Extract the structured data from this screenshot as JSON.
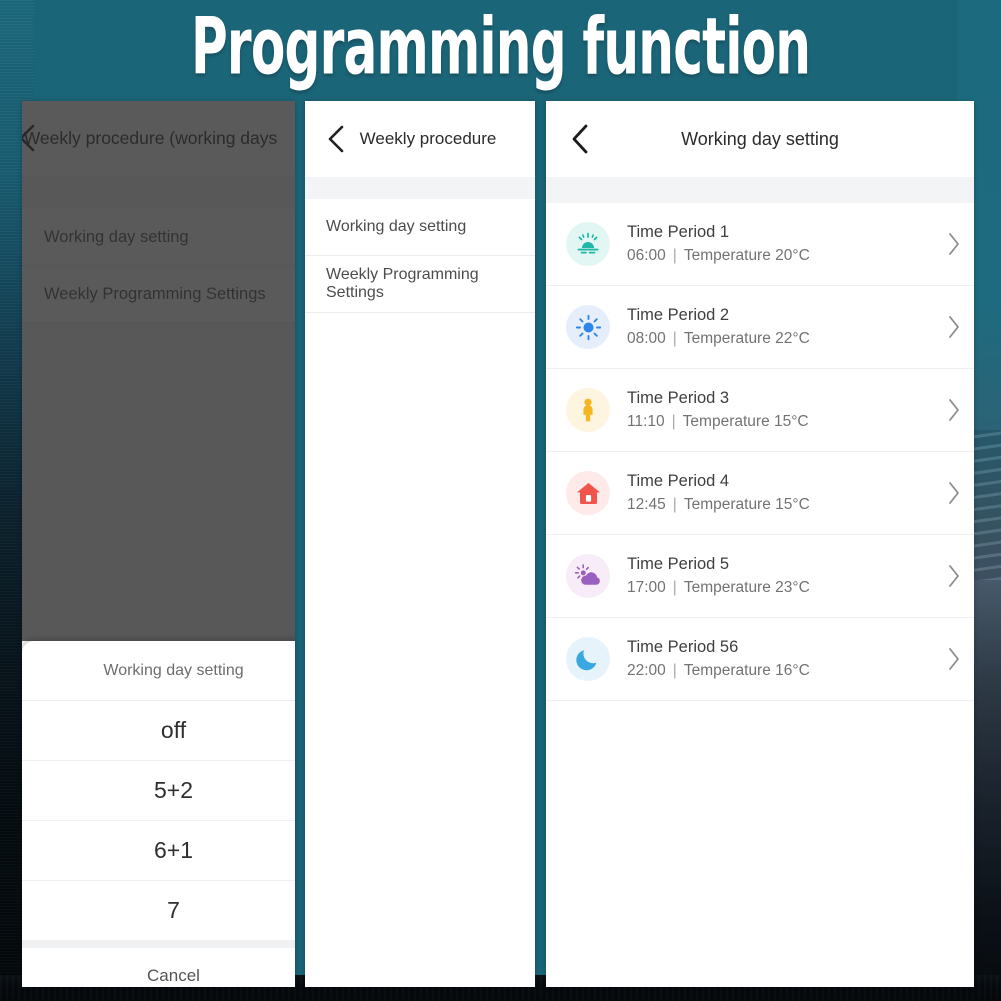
{
  "page": {
    "title": "Programming function",
    "accent_teal": "#1b6578",
    "title_color": "#ffffff"
  },
  "panel1": {
    "header": {
      "back_icon": "chevron-left-icon",
      "title": "Weekly procedure (working days"
    },
    "items": [
      {
        "label": "Working day setting"
      },
      {
        "label": "Weekly Programming Settings"
      }
    ],
    "action_sheet": {
      "title": "Working day setting",
      "options": [
        {
          "label": "off"
        },
        {
          "label": "5+2"
        },
        {
          "label": "6+1"
        },
        {
          "label": "7"
        }
      ],
      "cancel_label": "Cancel"
    }
  },
  "panel2": {
    "header": {
      "back_icon": "chevron-left-icon",
      "title": "Weekly procedure"
    },
    "items": [
      {
        "label": "Working day setting"
      },
      {
        "label": "Weekly Programming Settings"
      }
    ]
  },
  "panel3": {
    "header": {
      "back_icon": "chevron-left-icon",
      "title": "Working day setting"
    },
    "rows": [
      {
        "name": "Time Period 1",
        "time": "06:00",
        "separator": "|",
        "temperature": "Temperature 20°C",
        "icon": "sunrise-icon",
        "icon_color": "#1fb7a6",
        "icon_bg": "#e2f6f3"
      },
      {
        "name": "Time Period 2",
        "time": "08:00",
        "separator": "|",
        "temperature": "Temperature 22°C",
        "icon": "sun-icon",
        "icon_color": "#2f86e8",
        "icon_bg": "#e6eefb"
      },
      {
        "name": "Time Period 3",
        "time": "11:10",
        "separator": "|",
        "temperature": "Temperature 15°C",
        "icon": "person-icon",
        "icon_color": "#f5b623",
        "icon_bg": "#fdf5e0"
      },
      {
        "name": "Time Period 4",
        "time": "12:45",
        "separator": "|",
        "temperature": "Temperature 15°C",
        "icon": "home-icon",
        "icon_color": "#f0544a",
        "icon_bg": "#fdeae9"
      },
      {
        "name": "Time Period 5",
        "time": "17:00",
        "separator": "|",
        "temperature": "Temperature 23°C",
        "icon": "cloud-sun-icon",
        "icon_color": "#9b5fc0",
        "icon_bg": "#f7ecf8"
      },
      {
        "name": "Time Period 56",
        "time": "22:00",
        "separator": "|",
        "temperature": "Temperature 16°C",
        "icon": "moon-icon",
        "icon_color": "#3aa8e0",
        "icon_bg": "#e7f3fb"
      }
    ]
  }
}
